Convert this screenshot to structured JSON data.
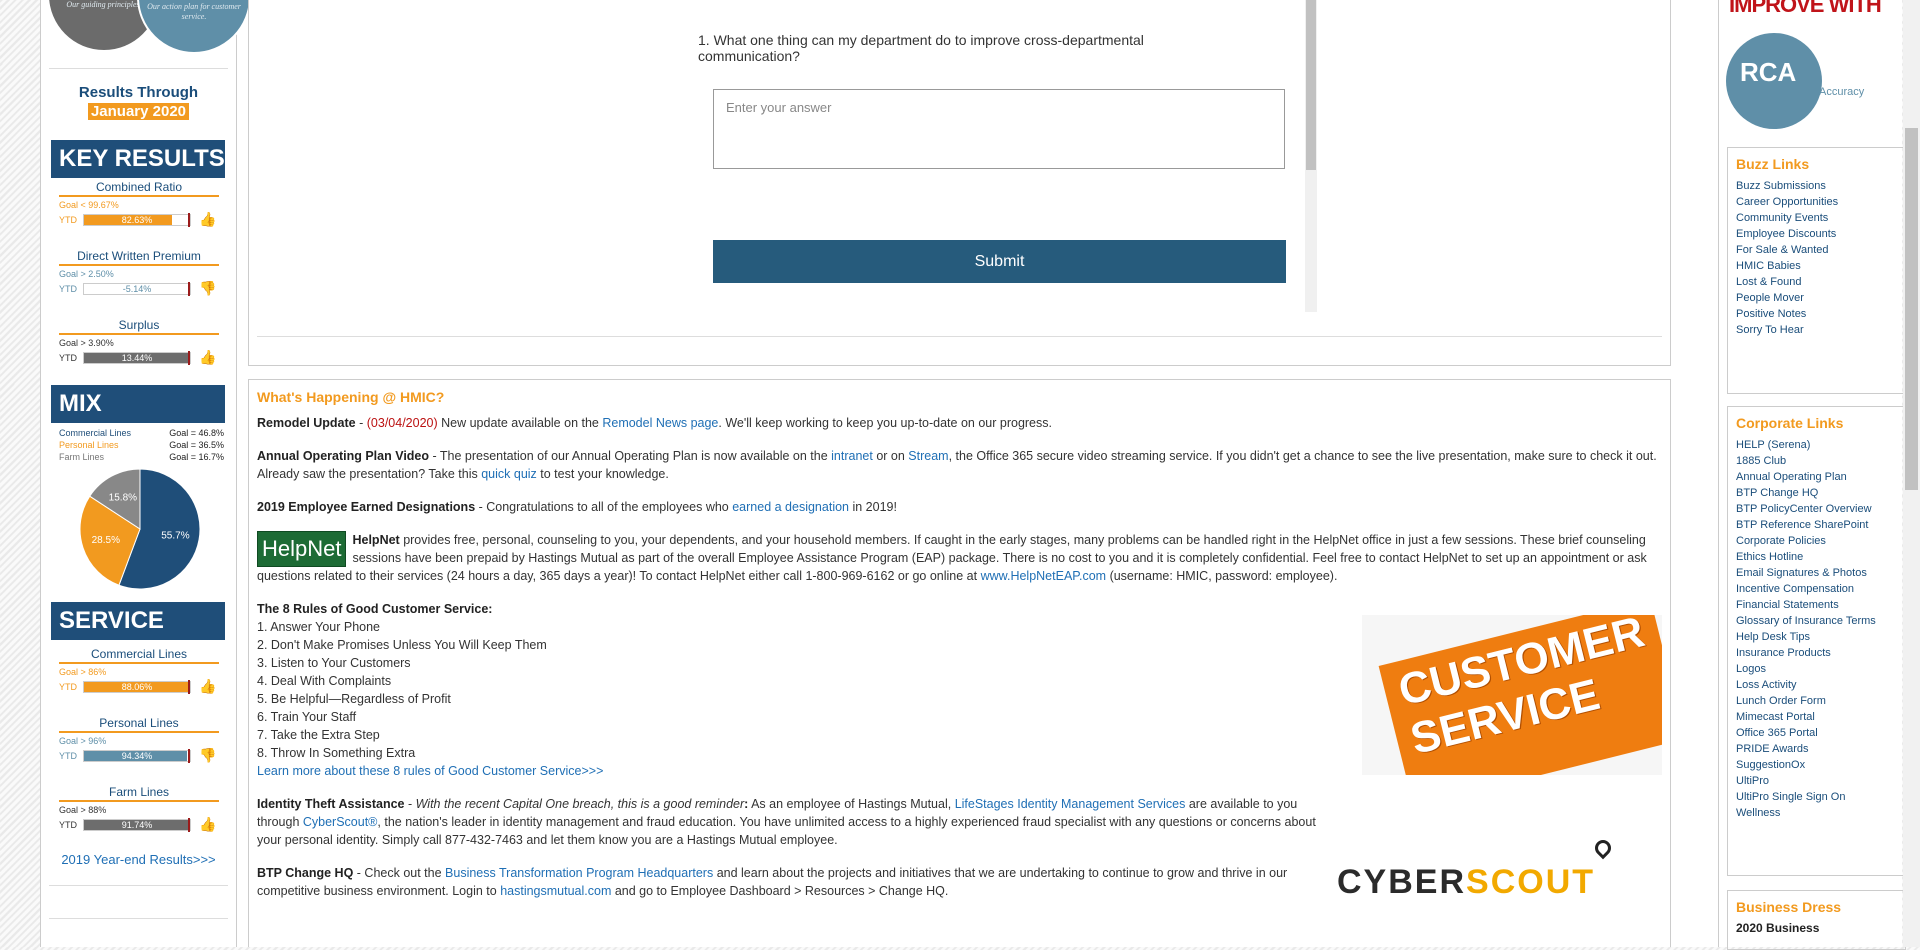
{
  "left": {
    "circle_left_text": "Our guiding principles.",
    "circle_right_text": "Our action plan for customer service.",
    "results_through": "Results Through",
    "results_month": "January 2020",
    "key_results_title": "KEY RESULTS",
    "key_results": [
      {
        "title": "Combined Ratio",
        "goal": "Goal < 99.67%",
        "ytd": "YTD",
        "value": "82.63%",
        "fill": 0.83,
        "color": "#f29a1f",
        "up": true
      },
      {
        "title": "Direct Written Premium",
        "goal": "Goal > 2.50%",
        "ytd": "YTD",
        "value": "-5.14%",
        "fill": 0.0,
        "color": "#5f8fa8",
        "up": false
      },
      {
        "title": "Surplus",
        "goal": "Goal > 3.90%",
        "ytd": "YTD",
        "value": "13.44%",
        "fill": 1.0,
        "color": "#6d6d6d",
        "up": true
      }
    ],
    "mix_title": "MIX",
    "mix_legend": [
      {
        "name": "Commercial Lines",
        "goal": "Goal = 46.8%",
        "color": "#1f4e79"
      },
      {
        "name": "Personal Lines",
        "goal": "Goal = 36.5%",
        "color": "#f29a1f"
      },
      {
        "name": "Farm Lines",
        "goal": "Goal = 16.7%",
        "color": "#777"
      }
    ],
    "pie": [
      {
        "label": "55.7%",
        "value": 55.7,
        "color": "#1f4e79"
      },
      {
        "label": "28.5%",
        "value": 28.5,
        "color": "#f29a1f"
      },
      {
        "label": "15.8%",
        "value": 15.8,
        "color": "#888888"
      }
    ],
    "service_title": "SERVICE",
    "service": [
      {
        "title": "Commercial Lines",
        "goal": "Goal > 86%",
        "ytd": "YTD",
        "value": "88.06%",
        "fill": 1.0,
        "color": "#f29a1f",
        "up": true
      },
      {
        "title": "Personal Lines",
        "goal": "Goal > 96%",
        "ytd": "YTD",
        "value": "94.34%",
        "fill": 0.97,
        "color": "#5f8fa8",
        "up": false
      },
      {
        "title": "Farm Lines",
        "goal": "Goal > 88%",
        "ytd": "YTD",
        "value": "91.74%",
        "fill": 1.0,
        "color": "#6d6d6d",
        "up": true
      }
    ],
    "year_end_link": "2019 Year-end Results>>>"
  },
  "survey": {
    "question": "1. What one thing can my department do to improve cross-departmental communication?",
    "placeholder": "Enter your answer",
    "submit": "Submit"
  },
  "news": {
    "title": "What's Happening @ HMIC?",
    "remodel": {
      "head": "Remodel Update",
      "date": "(03/04/2020)",
      "t1": " New update available on the ",
      "link": "Remodel News page",
      "t2": ". We'll keep working to keep you up-to-date on our progress."
    },
    "aop": {
      "head": "Annual Operating Plan Video",
      "t1": " - The presentation of our Annual Operating Plan is now available on the ",
      "l1": "intranet",
      "t2": " or on ",
      "l2": "Stream",
      "t3": ", the Office 365 secure video streaming service. If you didn't get a chance to see the live presentation, make sure to check it out. Already saw the presentation? Take this ",
      "l3": "quick quiz",
      "t4": " to test your knowledge."
    },
    "designations": {
      "head": "2019 Employee Earned Designations",
      "t1": " - Congratulations to all of the employees who ",
      "link": "earned a designation",
      "t2": " in 2019!"
    },
    "helpnet": {
      "logo": "HelpNet",
      "head": "HelpNet",
      "t1": " provides free, personal, counseling to you, your dependents, and your household members. If caught in the early stages, many problems can be handled right in the HelpNet office in just a few sessions. These brief counseling sessions have been prepaid by Hastings Mutual as part of the overall Employee Assistance Program (EAP) package. There is no cost to you and it is completely confidential. Feel free to contact HelpNet to set up an appointment or ask questions related to their services (24 hours a day, 365 days a year)! To contact HelpNet either call 1-800-969-6162 or go online at ",
      "link": "www.HelpNetEAP.com",
      "t2": " (username: HMIC, password: employee)."
    },
    "rules_head": "The 8 Rules of Good Customer Service:",
    "rules": [
      "1. Answer Your Phone",
      "2. Don't Make Promises Unless You Will Keep Them",
      "3. Listen to Your Customers",
      "4. Deal With Complaints",
      "5. Be Helpful—Regardless of Profit",
      "6. Train Your Staff",
      "7. Take the Extra Step",
      "8. Throw In Something Extra"
    ],
    "rules_link": "Learn more about these 8 rules of Good Customer Service>>>",
    "cs_image_text": "CUSTOMER SERVICE",
    "identity": {
      "head": "Identity Theft Assistance",
      "lead": "With the recent Capital One breach, this is a good reminder",
      "t1": " As an employee of Hastings Mutual, ",
      "l1": "LifeStages Identity Management Services",
      "t2": " are available to you through ",
      "l2": "CyberScout®",
      "t3": ", the nation's leader in identity management and fraud education. You have unlimited access to a highly experienced fraud specialist with any questions or concerns about your personal identity. Simply call 877-432-7463 and let them know you are a Hastings Mutual employee."
    },
    "cyber_a": "CYBER",
    "cyber_b": "SCOUT",
    "btp": {
      "head": "BTP Change HQ",
      "t1": " - Check out the ",
      "l1": "Business Transformation Program Headquarters",
      "t2": " and learn about the projects and initiatives that we are undertaking to continue to grow and thrive in our competitive business environment. Login to ",
      "l2": "hastingsmutual.com",
      "t3": " and go to Employee Dashboard > Resources > Change HQ."
    }
  },
  "right": {
    "top_banner": "IMPROVE WITH",
    "rca": "RCA",
    "rca_sub": "Accuracy",
    "buzz_title": "Buzz Links",
    "buzz": [
      "Buzz Submissions",
      "Career Opportunities",
      "Community Events",
      "Employee Discounts",
      "For Sale & Wanted",
      "HMIC Babies",
      "Lost & Found",
      "People Mover",
      "Positive Notes",
      "Sorry To Hear"
    ],
    "corp_title": "Corporate Links",
    "corp": [
      "HELP (Serena)",
      "1885 Club",
      "Annual Operating Plan",
      "BTP Change HQ",
      "BTP PolicyCenter Overview",
      "BTP Reference SharePoint",
      "Corporate Policies",
      "Ethics Hotline",
      "Email Signatures & Photos",
      "Incentive Compensation",
      "Financial Statements",
      "Glossary of Insurance Terms",
      "Help Desk Tips",
      "Insurance Products",
      "Logos",
      "Loss Activity",
      "Lunch Order Form",
      "Mimecast Portal",
      "Office 365 Portal",
      "PRIDE Awards",
      "SuggestionOx",
      "UltiPro",
      "UltiPro Single Sign On",
      "Wellness"
    ],
    "dress_title": "Business Dress",
    "dress_sub": "2020 Business"
  }
}
